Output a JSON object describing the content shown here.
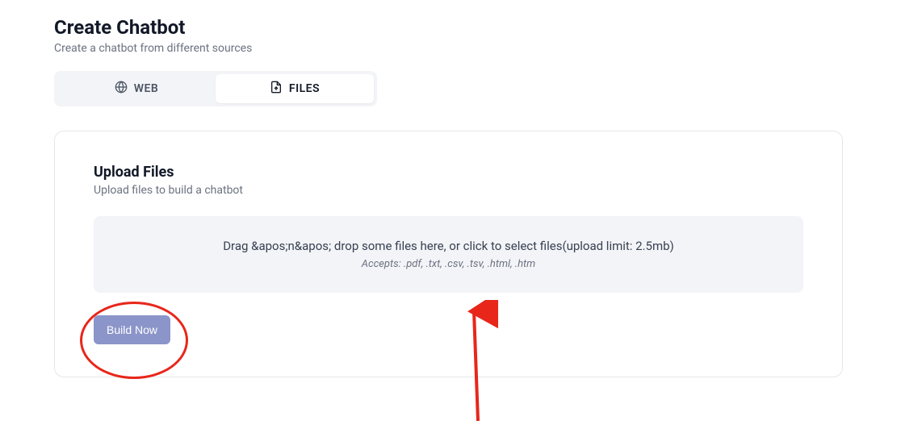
{
  "header": {
    "title": "Create Chatbot",
    "subtitle": "Create a chatbot from different sources"
  },
  "tabs": {
    "web_label": "WEB",
    "files_label": "FILES",
    "active": "files"
  },
  "upload": {
    "title": "Upload Files",
    "subtitle": "Upload files to build a chatbot",
    "dropzone_main": "Drag &apos;n&apos; drop some files here, or click to select files(upload limit: 2.5mb)",
    "dropzone_accepts": "Accepts: .pdf, .txt, .csv, .tsv, .html, .htm"
  },
  "actions": {
    "build_label": "Build Now"
  },
  "annotations": {
    "circle_color": "#e8261a",
    "arrow_color": "#e8261a"
  }
}
